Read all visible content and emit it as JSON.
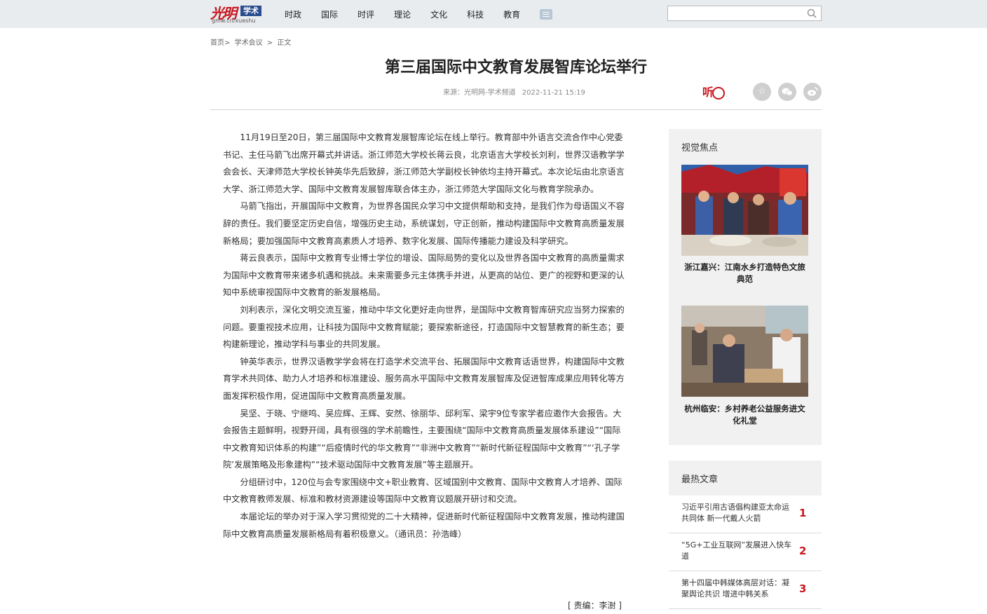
{
  "header": {
    "logo_script": "光明",
    "logo_badge": "学术",
    "logo_url": "gmw.cn/xueshu",
    "nav": [
      "时政",
      "国际",
      "时评",
      "理论",
      "文化",
      "科技",
      "教育"
    ],
    "search_placeholder": ""
  },
  "breadcrumb": [
    "首页>",
    "学术会议",
    ">",
    "正文"
  ],
  "article": {
    "title": "第三届国际中文教育发展智库论坛举行",
    "source": "来源：光明网-学术频道",
    "date": "2022-11-21 15:19",
    "listen_label": "听",
    "paragraphs": [
      "11月19日至20日，第三届国际中文教育发展智库论坛在线上举行。教育部中外语言交流合作中心党委书记、主任马箭飞出席开幕式并讲话。浙江师范大学校长蒋云良，北京语言大学校长刘利，世界汉语教学学会会长、天津师范大学校长钟英华先后致辞，浙江师范大学副校长钟依均主持开幕式。本次论坛由北京语言大学、浙江师范大学、国际中文教育发展智库联合体主办，浙江师范大学国际文化与教育学院承办。",
      "马箭飞指出，开展国际中文教育，为世界各国民众学习中文提供帮助和支持，是我们作为母语国义不容辞的责任。我们要坚定历史自信，增强历史主动，系统谋划，守正创新，推动构建国际中文教育高质量发展新格局；要加强国际中文教育高素质人才培养、数字化发展、国际传播能力建设及科学研究。",
      "蒋云良表示，国际中文教育专业博士学位的增设、国际局势的变化以及世界各国中文教育的高质量需求为国际中文教育带来诸多机遇和挑战。未来需要多元主体携手并进，从更高的站位、更广的视野和更深的认知中系统审视国际中文教育的新发展格局。",
      "刘利表示，深化文明交流互鉴，推动中华文化更好走向世界，是国际中文教育智库研究应当努力探索的问题。要重视技术应用，让科技为国际中文教育赋能；要探索新途径，打造国际中文智慧教育的新生态；要构建新理论，推动学科与事业的共同发展。",
      "钟英华表示，世界汉语教学学会将在打造学术交流平台、拓展国际中文教育话语世界，构建国际中文教育学术共同体、助力人才培养和标准建设、服务高水平国际中文教育发展智库及促进智库成果应用转化等方面发挥积极作用，促进国际中文教育高质量发展。",
      "吴坚、于晓、宁继鸣、吴应辉、王辉、安然、徐丽华、邱利军、梁宇9位专家学者应邀作大会报告。大会报告主题鲜明，视野开阔，具有很强的学术前瞻性，主要围绕“国际中文教育高质量发展体系建设”“国际中文教育知识体系的构建”“后疫情时代的华文教育”“非洲中文教育”“新时代新征程国际中文教育”“‘孔子学院’发展策略及形象建构”“技术驱动国际中文教育发展”等主题展开。",
      "分组研讨中，120位与会专家围绕中文+职业教育、区域国别中文教育、国际中文教育人才培养、国际中文教育教师发展、标准和教材资源建设等国际中文教育议题展开研讨和交流。",
      "本届论坛的举办对于深入学习贯彻党的二十大精神，促进新时代新征程国际中文教育发展，推动构建国际中文教育高质量发展新格局有着积极意义。（通讯员：孙浩峰）"
    ],
    "editor": "[ 责编：李澍 ]"
  },
  "sidebar": {
    "focus_title": "视觉焦点",
    "focus_items": [
      {
        "caption": "浙江嘉兴：江南水乡打造特色文旅典范"
      },
      {
        "caption": "杭州临安：乡村养老公益服务进文化礼堂"
      }
    ],
    "hot_title": "最热文章",
    "hot_items": [
      {
        "rank": "1",
        "title": "习近平引用古语倡构建亚太命运共同体 新一代戴人火箭"
      },
      {
        "rank": "2",
        "title": "“5G+工业互联网”发展进入快车道"
      },
      {
        "rank": "3",
        "title": "第十四届中韩媒体高层对话：凝聚舆论共识 增进中韩关系"
      }
    ]
  },
  "colors": {
    "brand_red": "#c8161e",
    "topbar": "#e9ecef",
    "panel": "#f1f1f1"
  },
  "icons": [
    "search-icon",
    "menu-list-icon",
    "listen-icon",
    "favorite-icon",
    "wechat-icon",
    "weibo-icon"
  ]
}
